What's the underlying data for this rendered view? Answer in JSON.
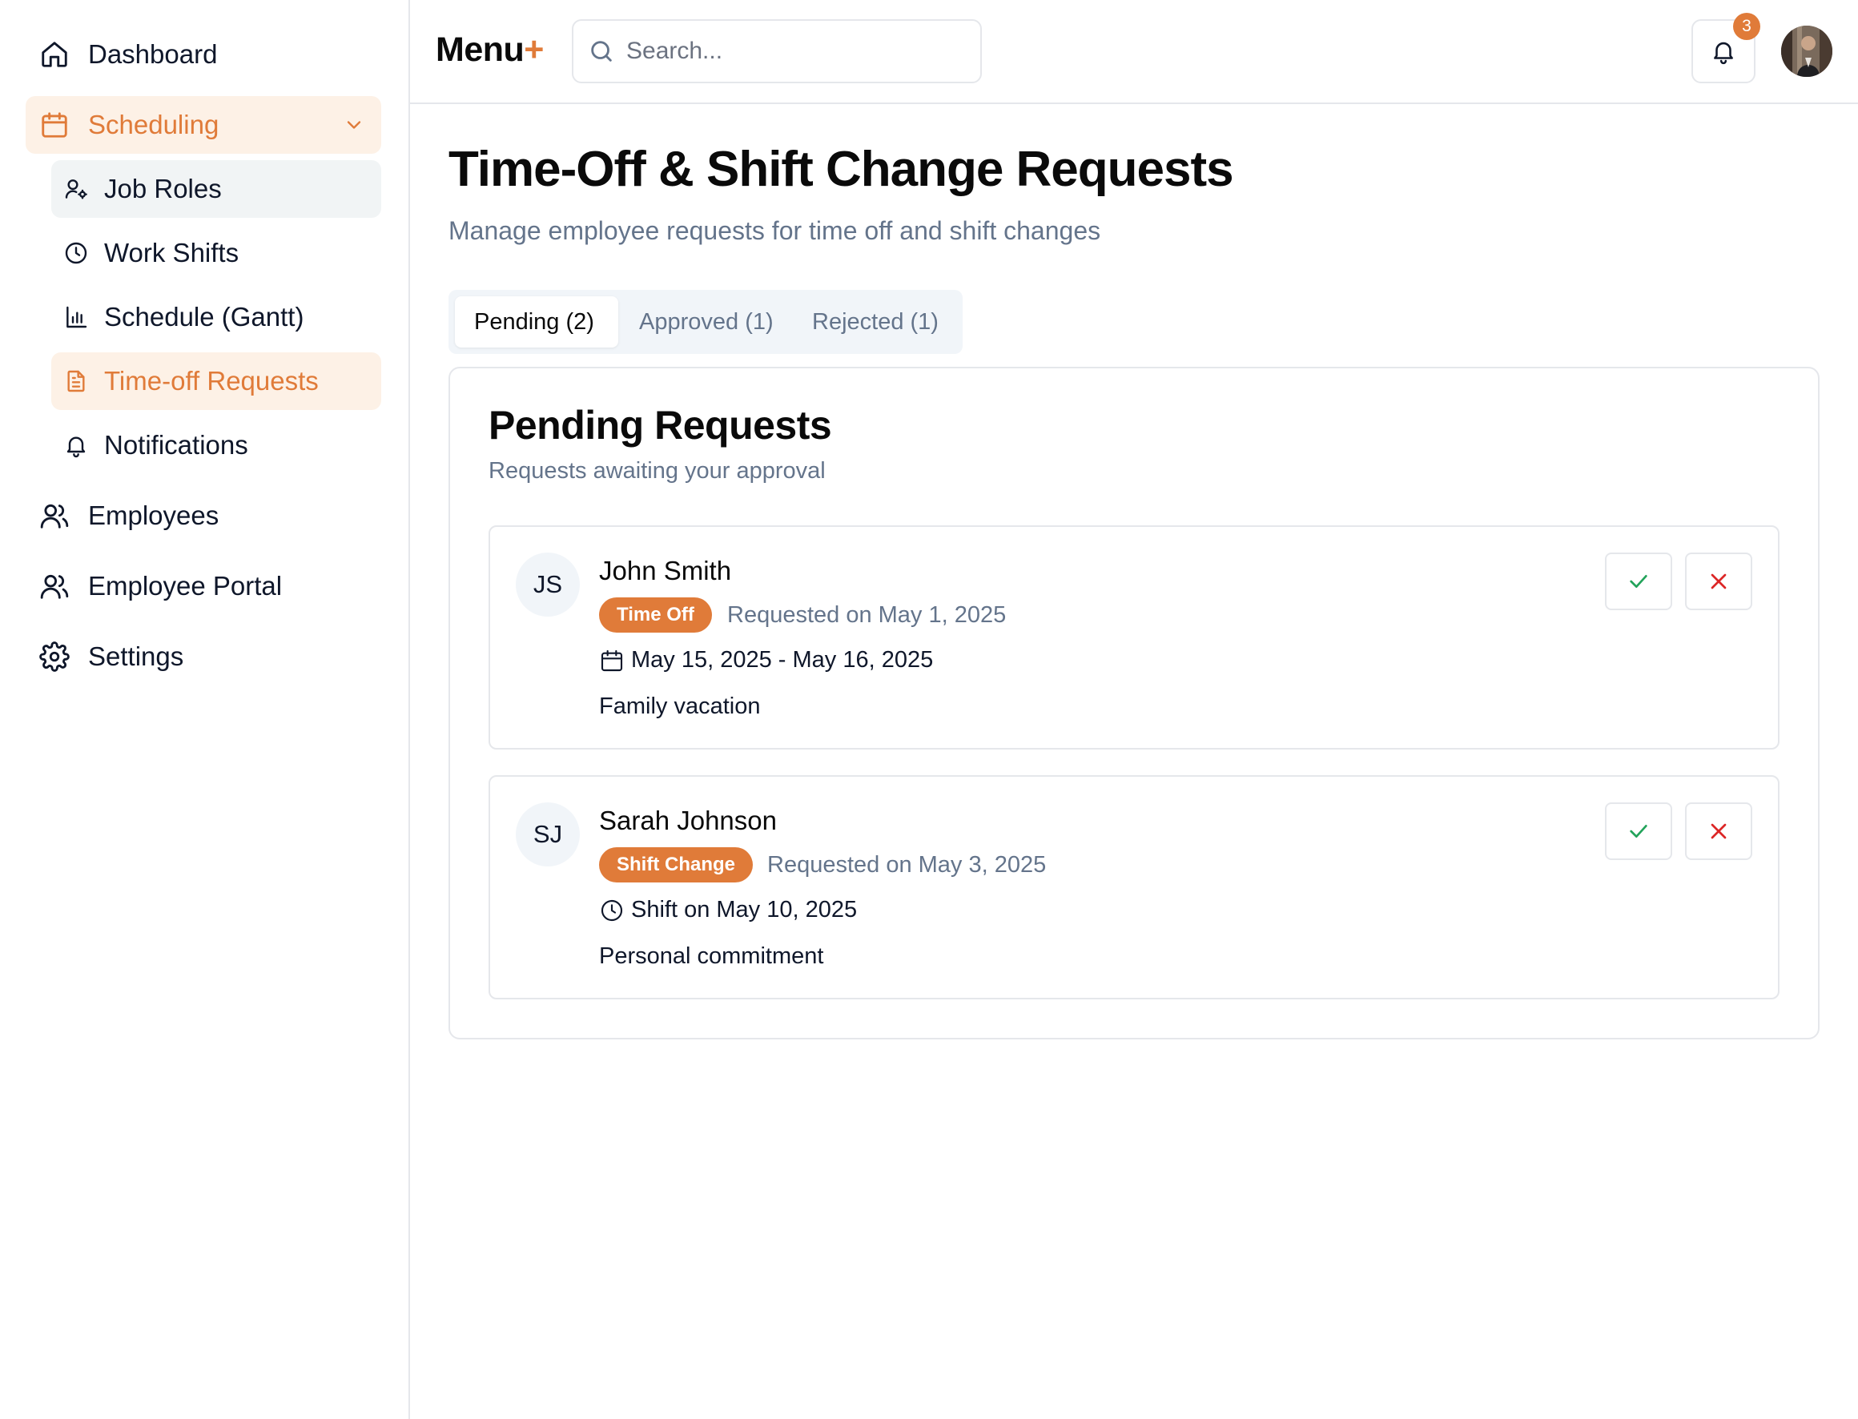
{
  "colors": {
    "accent": "#e07b39",
    "muted": "#64748b",
    "approve": "#22a35a",
    "reject": "#dc2626"
  },
  "sidebar": {
    "items": [
      {
        "label": "Dashboard",
        "icon": "home-icon"
      },
      {
        "label": "Scheduling",
        "icon": "calendar-icon",
        "expanded": true,
        "children": [
          {
            "label": "Job Roles",
            "icon": "user-cog-icon"
          },
          {
            "label": "Work Shifts",
            "icon": "clock-icon"
          },
          {
            "label": "Schedule (Gantt)",
            "icon": "bar-chart-icon"
          },
          {
            "label": "Time-off Requests",
            "icon": "file-text-icon",
            "active": true
          },
          {
            "label": "Notifications",
            "icon": "bell-icon"
          }
        ]
      },
      {
        "label": "Employees",
        "icon": "users-icon"
      },
      {
        "label": "Employee Portal",
        "icon": "users-icon"
      },
      {
        "label": "Settings",
        "icon": "gear-icon"
      }
    ]
  },
  "header": {
    "brand": "Menu",
    "brand_plus": "+",
    "search_placeholder": "Search...",
    "notification_count": "3"
  },
  "main": {
    "title": "Time-Off & Shift Change Requests",
    "subtitle": "Manage employee requests for time off and shift changes",
    "tabs": [
      {
        "label": "Pending (2)",
        "active": true
      },
      {
        "label": "Approved (1)"
      },
      {
        "label": "Rejected (1)"
      }
    ],
    "card": {
      "title": "Pending Requests",
      "subtitle": "Requests awaiting your approval",
      "requests": [
        {
          "initials": "JS",
          "name": "John Smith",
          "type": "Time Off",
          "requested": "Requested on May 1, 2025",
          "detail_icon": "calendar-icon",
          "detail": "May 15, 2025 - May 16, 2025",
          "note": "Family vacation"
        },
        {
          "initials": "SJ",
          "name": "Sarah Johnson",
          "type": "Shift Change",
          "requested": "Requested on May 3, 2025",
          "detail_icon": "clock-icon",
          "detail": "Shift on May 10, 2025",
          "note": "Personal commitment"
        }
      ]
    }
  }
}
